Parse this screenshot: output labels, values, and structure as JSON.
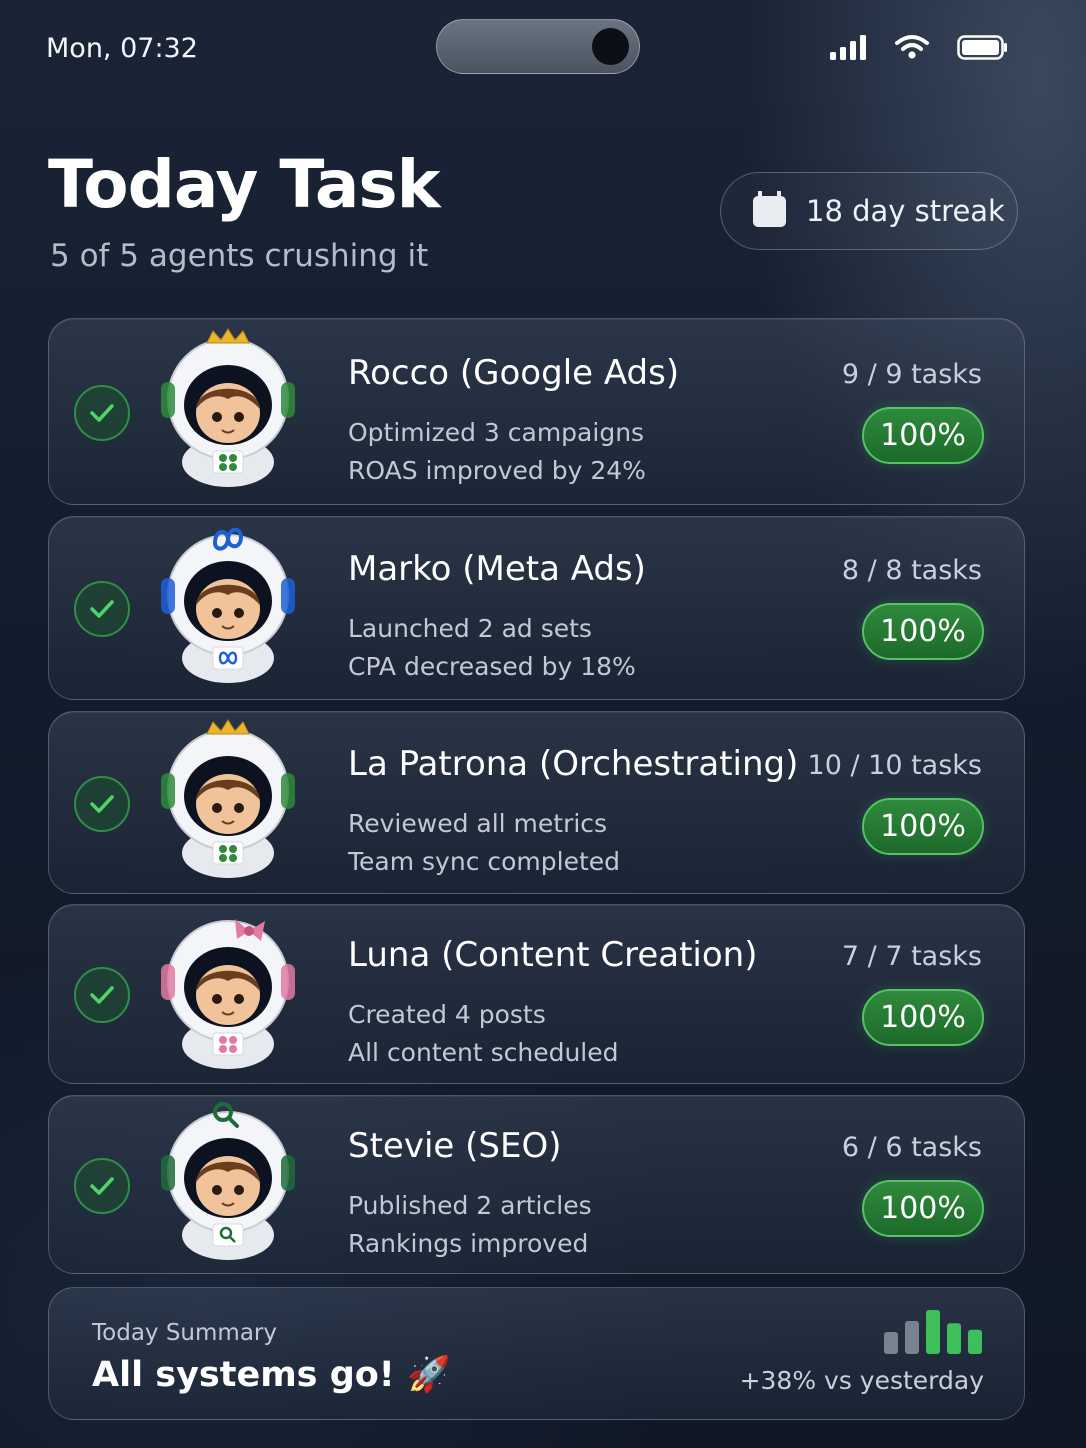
{
  "status_bar": {
    "time": "Mon, 07:32"
  },
  "header": {
    "title": "Today Task",
    "subtitle": "5 of 5 agents crushing it",
    "streak_label": "18 day streak"
  },
  "agents": [
    {
      "name": "Rocco (Google Ads)",
      "line1": "Optimized 3 campaigns",
      "line2": "ROAS improved by 24%",
      "tasks": "9 / 9 tasks",
      "percent": "100%",
      "avatar": "astronaut-crown-clover-icon",
      "accent": "#2f8a3c"
    },
    {
      "name": "Marko (Meta Ads)",
      "line1": "Launched 2 ad sets",
      "line2": "CPA decreased by 18%",
      "tasks": "8 / 8 tasks",
      "percent": "100%",
      "avatar": "astronaut-meta-icon",
      "accent": "#1f5fd6"
    },
    {
      "name": "La Patrona (Orchestrating)",
      "line1": "Reviewed all metrics",
      "line2": "Team sync completed",
      "tasks": "10 / 10 tasks",
      "percent": "100%",
      "avatar": "astronaut-crown-clover-icon",
      "accent": "#2f8a3c"
    },
    {
      "name": "Luna (Content Creation)",
      "line1": "Created 4 posts",
      "line2": "All content scheduled",
      "tasks": "7 / 7 tasks",
      "percent": "100%",
      "avatar": "astronaut-bow-icon",
      "accent": "#e27aa3"
    },
    {
      "name": "Stevie (SEO)",
      "line1": "Published 2 articles",
      "line2": "Rankings improved",
      "tasks": "6 / 6 tasks",
      "percent": "100%",
      "avatar": "astronaut-magnifier-icon",
      "accent": "#1f6b3a"
    }
  ],
  "summary": {
    "label": "Today Summary",
    "text": "All systems go! 🚀",
    "trend": "+38% vs yesterday",
    "trend_bar_levels": [
      0.5,
      0.75,
      1.0,
      0.7,
      0.55
    ]
  },
  "colors": {
    "accent_green": "#2f8a3c",
    "background": "#131c2c"
  }
}
